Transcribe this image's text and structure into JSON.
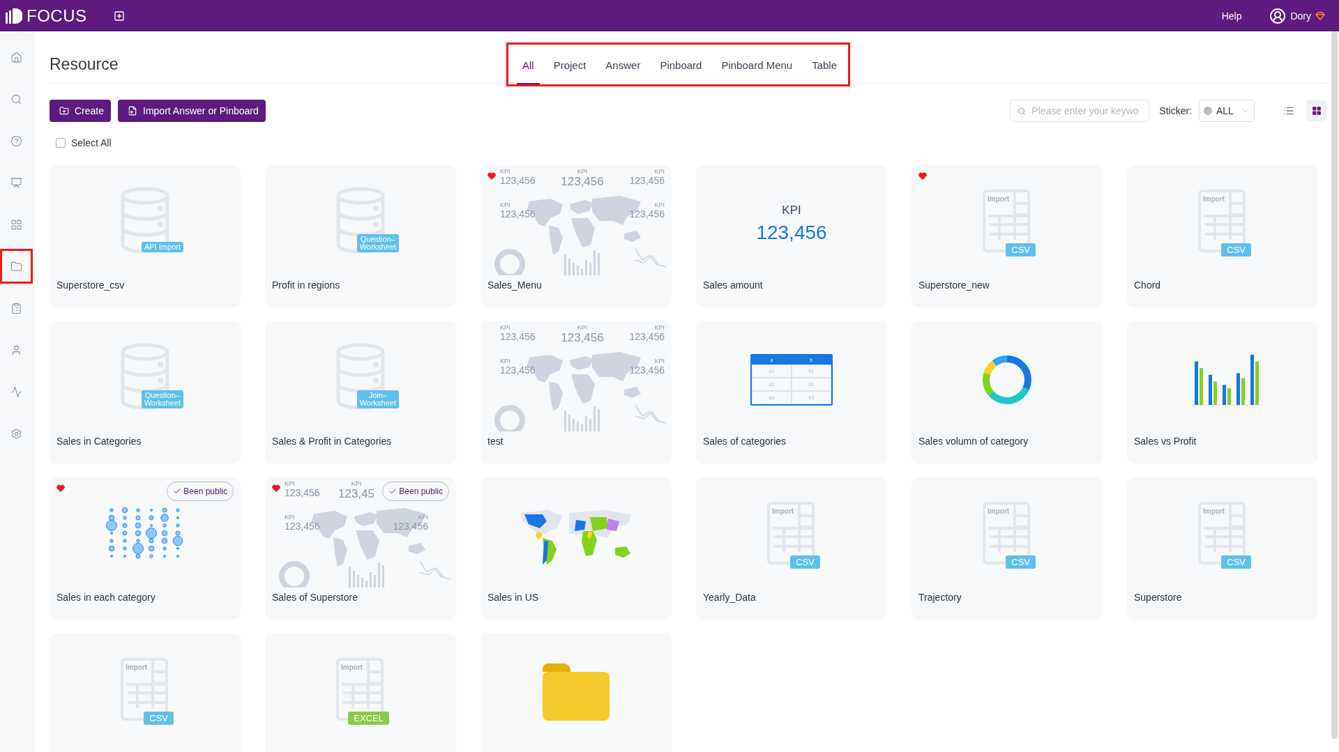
{
  "topbar": {
    "logo": "FOCUS",
    "help": "Help",
    "user": "Dory"
  },
  "sidebar": {
    "items": [
      {
        "highlighted": false
      },
      {
        "highlighted": false
      },
      {
        "highlighted": false
      },
      {
        "highlighted": false
      },
      {
        "highlighted": false
      },
      {
        "highlighted": true
      },
      {
        "highlighted": false
      },
      {
        "highlighted": false
      },
      {
        "highlighted": false
      },
      {
        "highlighted": false
      }
    ]
  },
  "page": {
    "title": "Resource",
    "tabs_highlighted": true
  },
  "tabs": [
    {
      "label": "All",
      "selected": true
    },
    {
      "label": "Project",
      "selected": false
    },
    {
      "label": "Answer",
      "selected": false
    },
    {
      "label": "Pinboard",
      "selected": false
    },
    {
      "label": "Pinboard Menu",
      "selected": false
    },
    {
      "label": "Table",
      "selected": false
    }
  ],
  "toolbar": {
    "create": "Create",
    "import": "Import Answer or Pinboard",
    "search": {
      "placeholder": "Please enter your keywo"
    },
    "sticker_label": "Sticker:",
    "sticker_value": "ALL",
    "views": [
      {
        "selected": false
      },
      {
        "selected": true
      }
    ]
  },
  "select_all": {
    "label": "Select All",
    "checked": false
  },
  "cards": [
    {
      "title": "Superstore_csv",
      "kind": "db",
      "badge": [
        "API Import"
      ],
      "favorite": false
    },
    {
      "title": "Profit in regions",
      "kind": "db",
      "badge": [
        "Question–",
        "Worksheet"
      ],
      "favorite": false
    },
    {
      "title": "Sales_Menu",
      "kind": "dashboard",
      "kpis": [
        {
          "kind": "top-left",
          "label": "KPI",
          "value": "123,456"
        },
        {
          "kind": "top-center",
          "label": "KPI",
          "value": "123,456"
        },
        {
          "kind": "top-right",
          "label": "KPI",
          "value": "123,456"
        },
        {
          "kind": "middle-left",
          "label": "KPI",
          "value": "123,456"
        },
        {
          "kind": "middle-right",
          "label": "KPI",
          "value": "123,456"
        }
      ],
      "favorite": true
    },
    {
      "title": "Sales amount",
      "kind": "kpi",
      "kpi": {
        "label": "KPI",
        "value": "123,456"
      },
      "favorite": false
    },
    {
      "title": "Superstore_new",
      "kind": "file",
      "import": "Import",
      "badge": [
        "CSV"
      ],
      "color": "#5ec0ea",
      "favorite": true
    },
    {
      "title": "Chord",
      "kind": "file",
      "import": "Import",
      "badge": [
        "CSV"
      ],
      "color": "#5ec0ea",
      "favorite": false
    },
    {
      "title": "Sales in Categories",
      "kind": "db",
      "badge": [
        "Question–",
        "Worksheet"
      ],
      "favorite": false
    },
    {
      "title": "Sales & Profit in Categories",
      "kind": "db",
      "badge": [
        "Join–",
        "Worksheet"
      ],
      "favorite": false
    },
    {
      "title": "test",
      "kind": "dashboard",
      "kpis": [
        {
          "kind": "top-left",
          "label": "KPI",
          "value": "123,456"
        },
        {
          "kind": "top-center",
          "label": "KPI",
          "value": "123,456"
        },
        {
          "kind": "top-right",
          "label": "KPI",
          "value": "123,456"
        },
        {
          "kind": "middle-left",
          "label": "KPI",
          "value": "123,456"
        },
        {
          "kind": "middle-right",
          "label": "KPI",
          "value": "123,456"
        }
      ],
      "favorite": false
    },
    {
      "title": "Sales of categories",
      "kind": "table",
      "header": [
        "a",
        "b"
      ],
      "rows": [
        [
          "a1",
          "b1"
        ],
        [
          "a2",
          "b2"
        ],
        [
          "a3",
          "b3"
        ]
      ],
      "favorite": false
    },
    {
      "title": "Sales volumn of category",
      "kind": "donut",
      "favorite": false
    },
    {
      "title": "Sales vs Profit",
      "kind": "bars",
      "favorite": false
    },
    {
      "title": "Sales in each category",
      "kind": "bubble",
      "favorite": true,
      "public": "Been public"
    },
    {
      "title": "Sales of Superstore",
      "kind": "dashboard",
      "kpis": [
        {
          "kind": "top-left",
          "label": "KPI",
          "value": "123,456"
        },
        {
          "kind": "top-center",
          "label": "KPI",
          "value": "123,45"
        },
        {
          "kind": "middle-left",
          "label": "KPI",
          "value": "123,456"
        },
        {
          "kind": "middle-right",
          "label": "KPI",
          "value": "123,456"
        }
      ],
      "favorite": true,
      "public": "Been public"
    },
    {
      "title": "Sales in US",
      "kind": "map",
      "favorite": false
    },
    {
      "title": "Yearly_Data",
      "kind": "file",
      "import": "Import",
      "badge": [
        "CSV"
      ],
      "color": "#5ec0ea",
      "favorite": false
    },
    {
      "title": "Trajectory",
      "kind": "file",
      "import": "Import",
      "badge": [
        "CSV"
      ],
      "color": "#5ec0ea",
      "favorite": false
    },
    {
      "title": "Superstore",
      "kind": "file",
      "import": "Import",
      "badge": [
        "CSV"
      ],
      "color": "#5ec0ea",
      "favorite": false
    },
    {
      "kind": "file",
      "import": "Import",
      "badge": [
        "CSV"
      ],
      "color": "#5ec0ea",
      "favorite": false
    },
    {
      "kind": "file",
      "import": "Import",
      "badge": [
        "EXCEL"
      ],
      "color": "#8cc84b",
      "favorite": false
    },
    {
      "kind": "folder",
      "favorite": false
    }
  ]
}
